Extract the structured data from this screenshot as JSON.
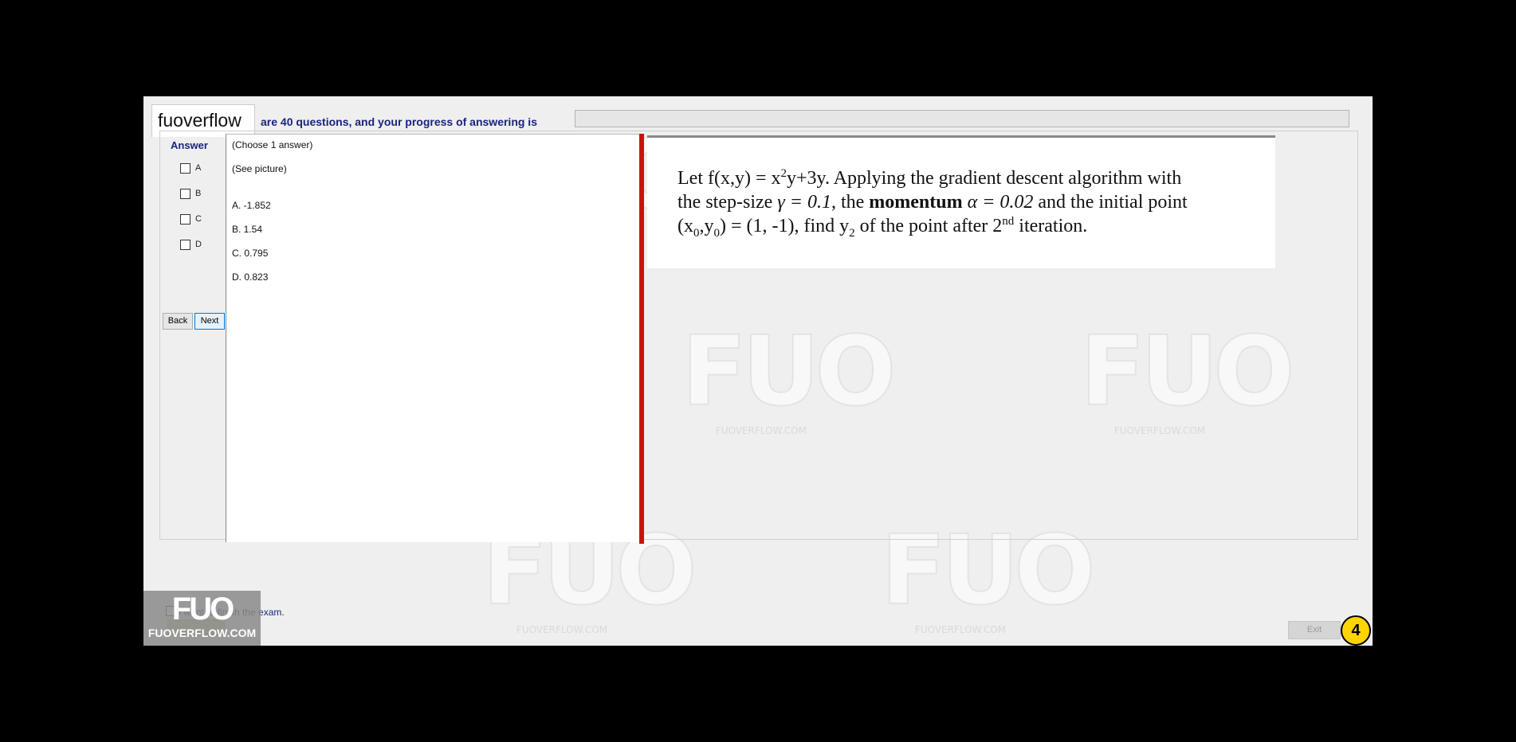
{
  "header": {
    "logo_text": "fuoverflow",
    "progress_label": "are 40 questions, and your progress of answering is",
    "progress_value": 0
  },
  "answer_panel": {
    "title": "Answer",
    "options": [
      "A",
      "B",
      "C",
      "D"
    ],
    "back_label": "Back",
    "next_label": "Next"
  },
  "question": {
    "instruction": "(Choose 1 answer)",
    "see_picture": "(See picture)",
    "choices": [
      "A.  -1.852",
      "B.  1.54",
      "C.  0.795",
      "D.  0.823"
    ]
  },
  "image_text": {
    "line1_a": "Let f(x,y) = x",
    "line1_sup": "2",
    "line1_b": "y+3y. Applying the gradient descent algorithm with",
    "line2_a": "the step-size ",
    "line2_gamma": "γ = 0.1",
    "line2_b": ", the ",
    "line2_bold": "momentum",
    "line2_alpha": " α = 0.02",
    "line2_c": " and the initial point",
    "line3_a": "(x",
    "line3_sub1": "0",
    "line3_b": ",y",
    "line3_sub2": "0",
    "line3_c": ") = (1, -1), find y",
    "line3_sub3": "2",
    "line3_d": " of the point after 2",
    "line3_sup": "nd",
    "line3_e": " iteration."
  },
  "footer": {
    "finish_label": "I want to finish the exam.",
    "exit_label": "Exit",
    "question_number": "4"
  },
  "watermark": {
    "brand": "FUO",
    "site": "FUOVERFLOW.COM"
  }
}
